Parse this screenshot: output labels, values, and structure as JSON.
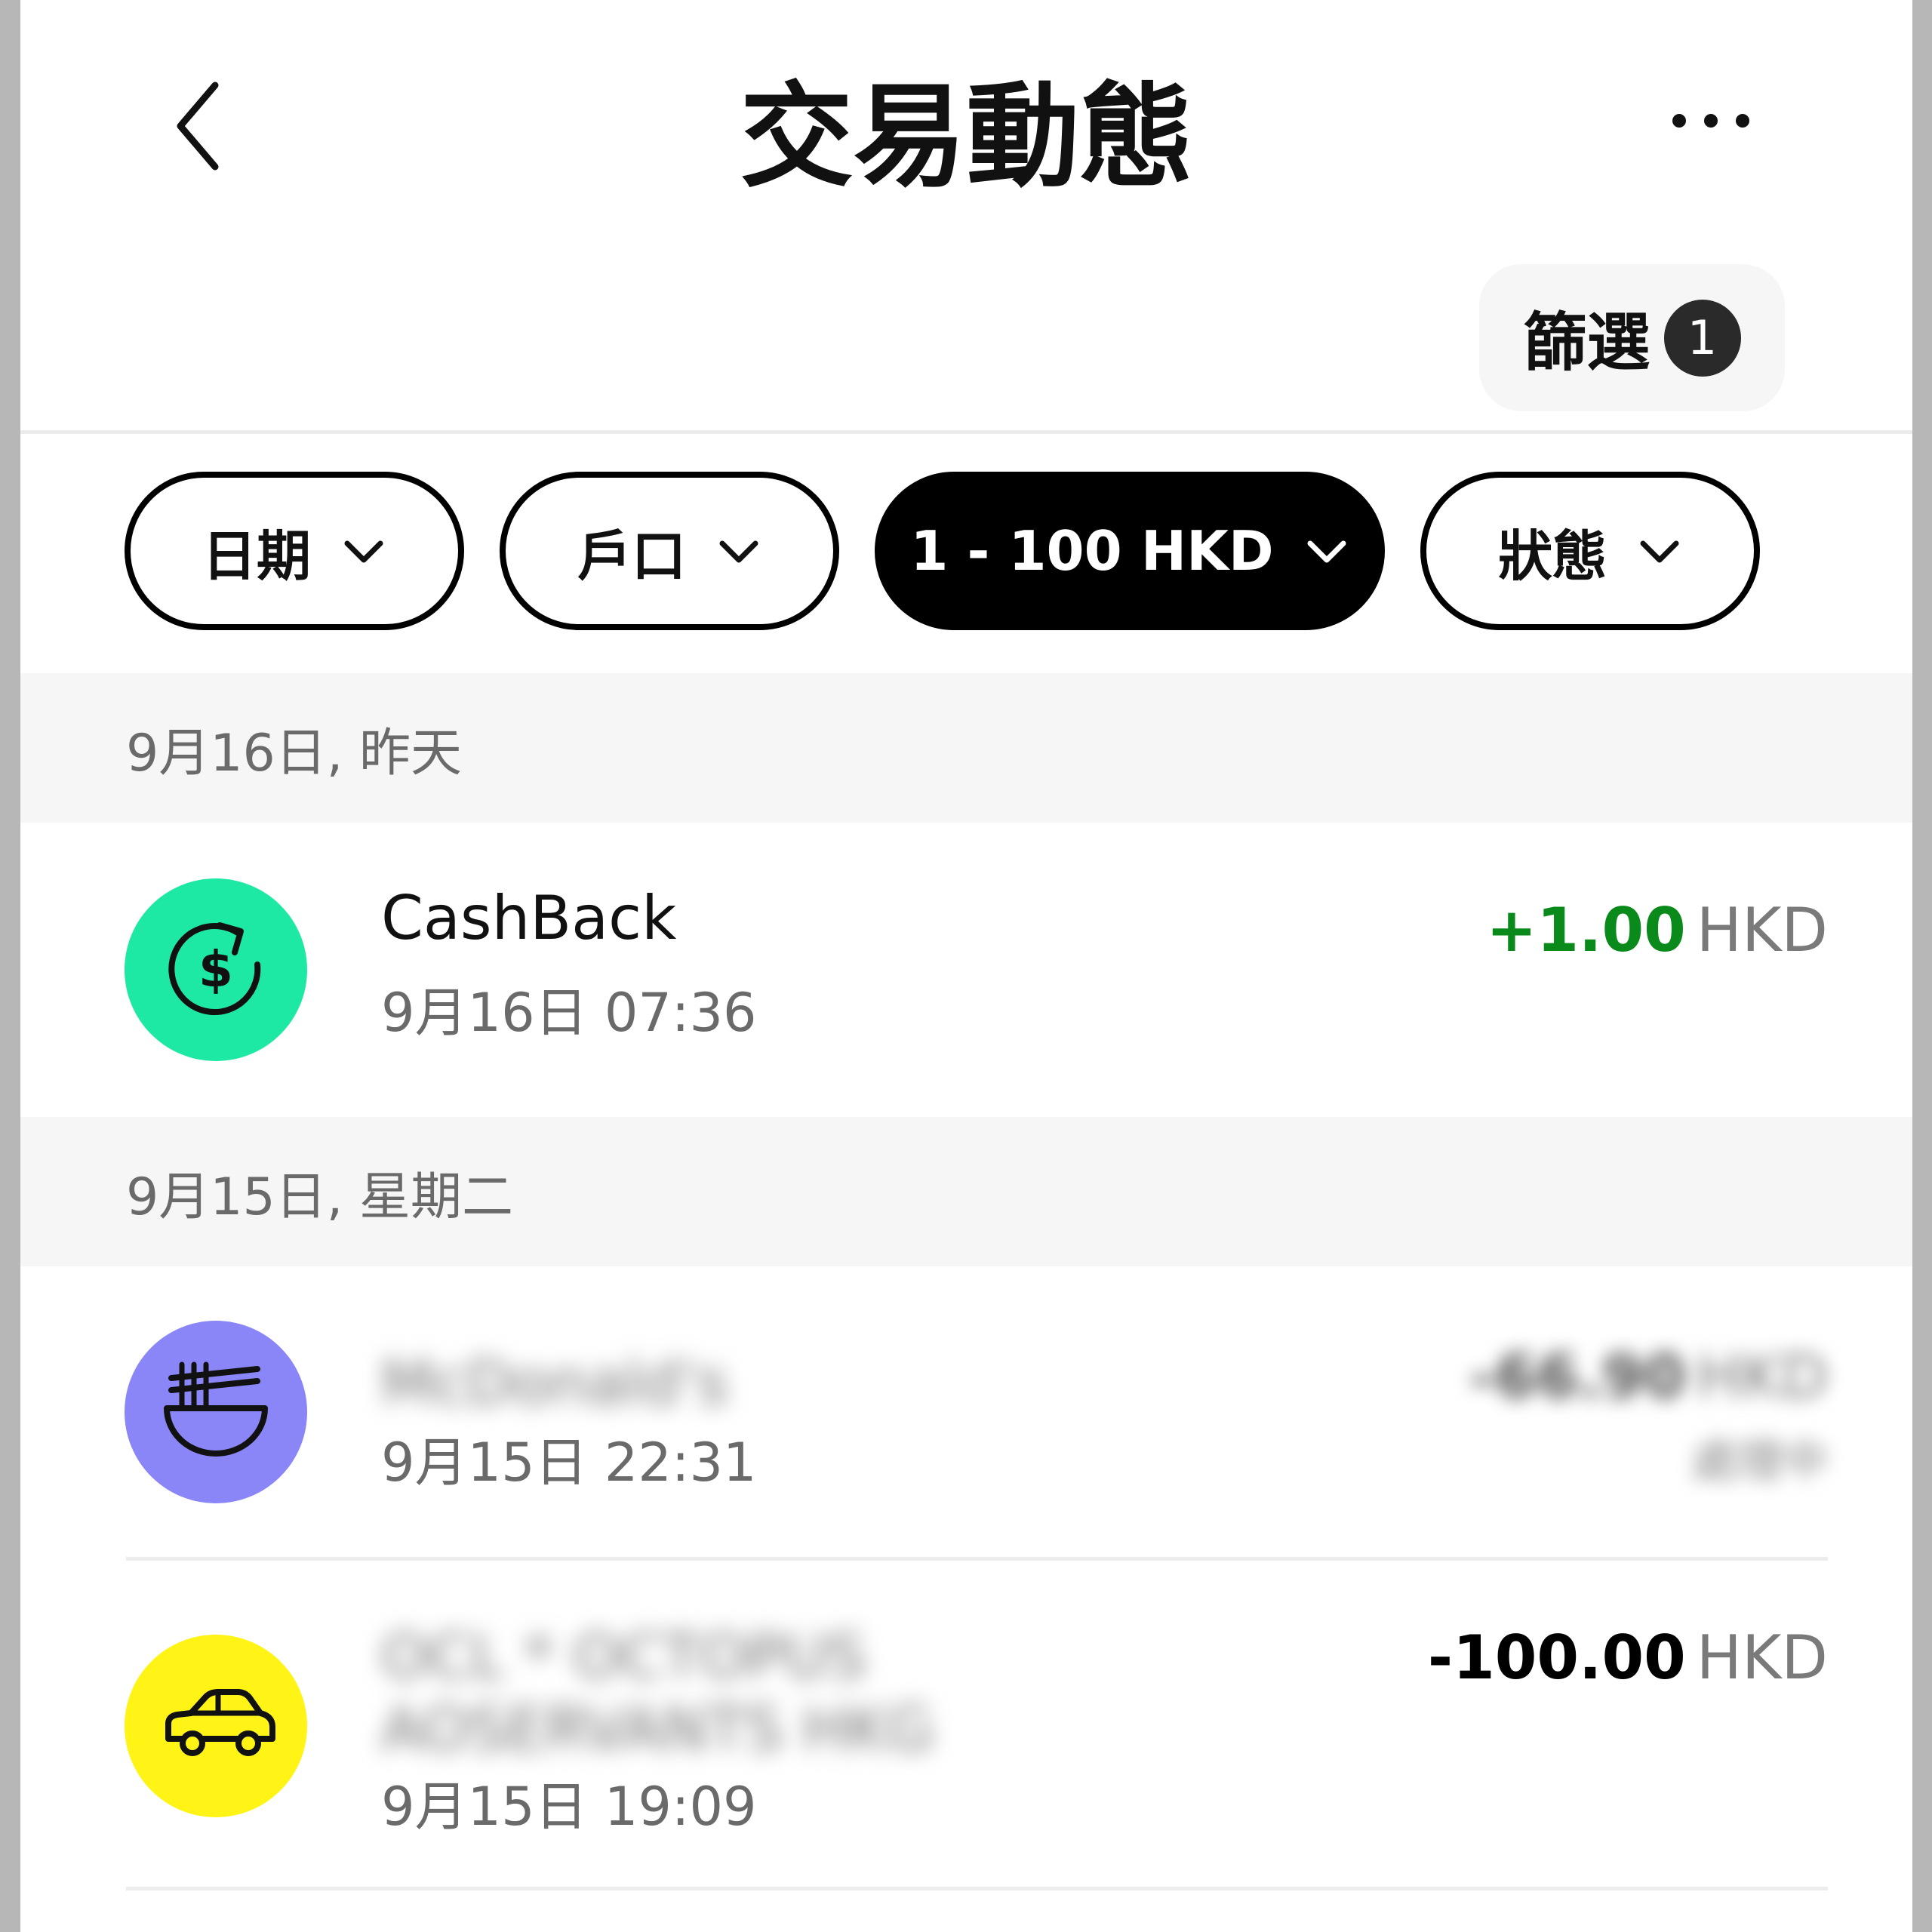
{
  "header": {
    "title": "交易動態",
    "filter_label": "篩選",
    "filter_count": "1"
  },
  "chips": [
    {
      "label": "日期",
      "active": false
    },
    {
      "label": "戶口",
      "active": false
    },
    {
      "label": "1 - 100 HKD",
      "active": true
    },
    {
      "label": "狀態",
      "active": false
    }
  ],
  "sections": [
    {
      "date_label": "9月16日, 昨天",
      "transactions": [
        {
          "merchant": "CashBack",
          "time": "9月16日 07:36",
          "amount": "+1.00",
          "currency": "HKD",
          "icon": "cashback-icon",
          "icon_bg": "#1de9a4",
          "amount_color": "#0a8a1a"
        }
      ]
    },
    {
      "date_label": "9月15日, 星期二",
      "transactions": [
        {
          "merchant": "McDonald's",
          "time": "9月15日 22:31",
          "amount": "-66.90",
          "currency": "HKD",
          "sub_amount": "處理中",
          "icon": "noodle-bowl-icon",
          "icon_bg": "#8a86f8",
          "amount_color": "#111111"
        },
        {
          "merchant": "OCL * OCTOPUS AOSERVANTS HKG",
          "time": "9月15日 19:09",
          "amount": "-100.00",
          "currency": "HKD",
          "icon": "car-icon",
          "icon_bg": "#fff416",
          "amount_color": "#111111"
        }
      ]
    }
  ]
}
